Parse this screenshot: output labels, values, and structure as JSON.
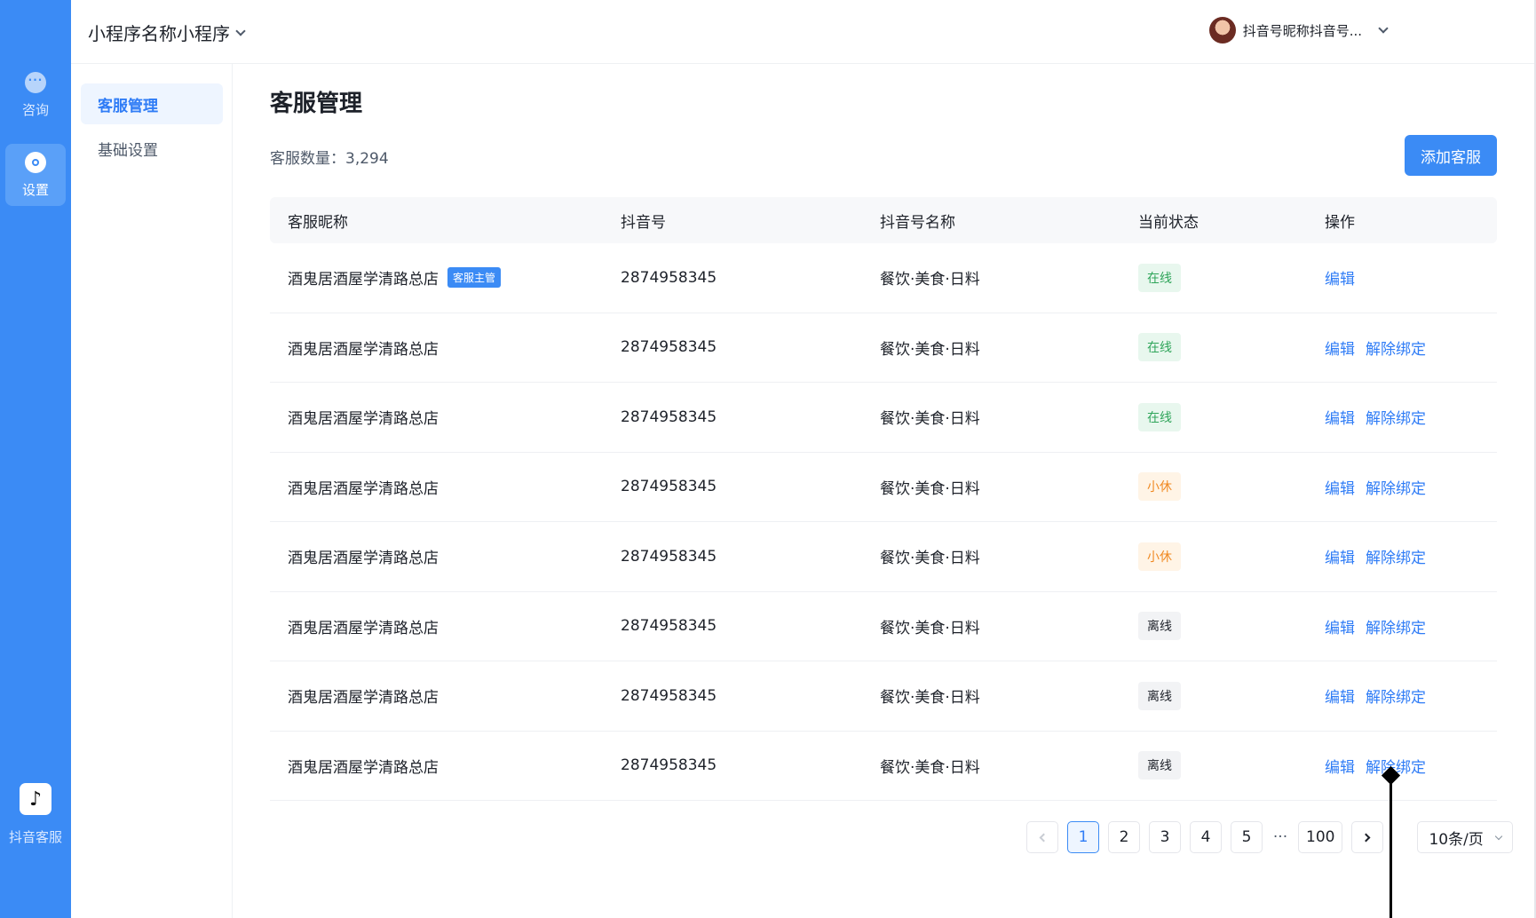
{
  "rail": {
    "items": [
      {
        "label": "咨询",
        "icon": "chat-bubble-icon"
      },
      {
        "label": "设置",
        "icon": "settings-icon"
      }
    ],
    "bottom_label": "抖音客服",
    "bottom_logo_glyph": "♪"
  },
  "header": {
    "app_name": "小程序名称小程序",
    "account_name": "抖音号昵称抖音号..."
  },
  "subnav": {
    "items": [
      {
        "label": "客服管理"
      },
      {
        "label": "基础设置"
      }
    ]
  },
  "main": {
    "title": "客服管理",
    "count_label": "客服数量：3,294",
    "add_button": "添加客服",
    "columns": [
      "客服昵称",
      "抖音号",
      "抖音号名称",
      "当前状态",
      "操作"
    ],
    "rows": [
      {
        "nickname": "酒鬼居酒屋学清路总店",
        "tag": "客服主管",
        "douyin_id": "2874958345",
        "account_name": "餐饮·美食·日料",
        "status": "在线",
        "actions": [
          "编辑"
        ]
      },
      {
        "nickname": "酒鬼居酒屋学清路总店",
        "douyin_id": "2874958345",
        "account_name": "餐饮·美食·日料",
        "status": "在线",
        "actions": [
          "编辑",
          "解除绑定"
        ]
      },
      {
        "nickname": "酒鬼居酒屋学清路总店",
        "douyin_id": "2874958345",
        "account_name": "餐饮·美食·日料",
        "status": "在线",
        "actions": [
          "编辑",
          "解除绑定"
        ]
      },
      {
        "nickname": "酒鬼居酒屋学清路总店",
        "douyin_id": "2874958345",
        "account_name": "餐饮·美食·日料",
        "status": "小休",
        "actions": [
          "编辑",
          "解除绑定"
        ]
      },
      {
        "nickname": "酒鬼居酒屋学清路总店",
        "douyin_id": "2874958345",
        "account_name": "餐饮·美食·日料",
        "status": "小休",
        "actions": [
          "编辑",
          "解除绑定"
        ]
      },
      {
        "nickname": "酒鬼居酒屋学清路总店",
        "douyin_id": "2874958345",
        "account_name": "餐饮·美食·日料",
        "status": "离线",
        "actions": [
          "编辑",
          "解除绑定"
        ]
      },
      {
        "nickname": "酒鬼居酒屋学清路总店",
        "douyin_id": "2874958345",
        "account_name": "餐饮·美食·日料",
        "status": "离线",
        "actions": [
          "编辑",
          "解除绑定"
        ]
      },
      {
        "nickname": "酒鬼居酒屋学清路总店",
        "douyin_id": "2874958345",
        "account_name": "餐饮·美食·日料",
        "status": "离线",
        "actions": [
          "编辑",
          "解除绑定"
        ]
      }
    ]
  },
  "status_colors": {
    "在线": {
      "bg": "#e8f7ee",
      "fg": "#2fa55a"
    },
    "小休": {
      "bg": "#fff4e6",
      "fg": "#f08a24"
    },
    "离线": {
      "bg": "#f2f3f5",
      "fg": "#1d2129"
    }
  },
  "pagination": {
    "pages": [
      "1",
      "2",
      "3",
      "4",
      "5"
    ],
    "ellipsis": "···",
    "last_page": "100",
    "current_page": "1",
    "page_size": "10条/页"
  },
  "colors": {
    "accent": "#3b8bf5",
    "link": "#2f7cf6"
  }
}
